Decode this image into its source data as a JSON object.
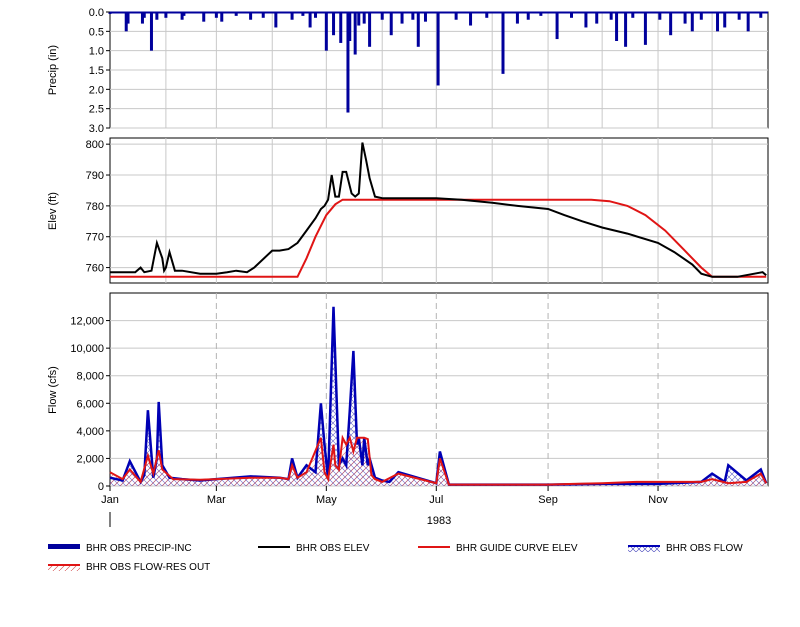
{
  "colors": {
    "precip": "#00009c",
    "elev": "#000000",
    "guide": "#e01515",
    "flow": "#0000b4",
    "res_out": "#e01515",
    "grid": "#c8c8c8",
    "month_line": "#b4b4b4"
  },
  "chart_data": [
    {
      "type": "bar",
      "ylabel": "Precip (in)",
      "ylim": [
        0.0,
        3.0
      ],
      "y_inverted": true,
      "yticks": [
        "0.0",
        "0.5",
        "1.0",
        "1.5",
        "2.0",
        "2.5",
        "3.0"
      ],
      "grid": true,
      "series": [
        {
          "name": "BHR OBS PRECIP-INC",
          "x": [
            "Jan 01",
            "Jan 10",
            "Jan 11",
            "Jan 19",
            "Jan 20",
            "Jan 24",
            "Jan 27",
            "Feb 01",
            "Feb 10",
            "Feb 11",
            "Feb 22",
            "Mar 01",
            "Mar 04",
            "Mar 12",
            "Mar 20",
            "Mar 27",
            "Apr 03",
            "Apr 12",
            "Apr 18",
            "Apr 22",
            "Apr 25",
            "May 01",
            "May 05",
            "May 09",
            "May 13",
            "May 14",
            "May 17",
            "May 19",
            "May 22",
            "May 25",
            "Jun 01",
            "Jun 06",
            "Jun 12",
            "Jun 18",
            "Jun 21",
            "Jun 25",
            "Jul 02",
            "Jul 12",
            "Jul 20",
            "Jul 29",
            "Aug 07",
            "Aug 15",
            "Aug 21",
            "Aug 28",
            "Sep 06",
            "Sep 14",
            "Sep 22",
            "Sep 28",
            "Oct 06",
            "Oct 09",
            "Oct 14",
            "Oct 18",
            "Oct 25",
            "Nov 02",
            "Nov 08",
            "Nov 16",
            "Nov 20",
            "Nov 25",
            "Dec 04",
            "Dec 08",
            "Dec 16",
            "Dec 21",
            "Dec 28"
          ],
          "values": [
            0.05,
            0.5,
            0.3,
            0.3,
            0.15,
            1.0,
            0.2,
            0.15,
            0.2,
            0.1,
            0.25,
            0.15,
            0.25,
            0.1,
            0.2,
            0.15,
            0.4,
            0.2,
            0.1,
            0.4,
            0.15,
            1.0,
            0.6,
            0.8,
            2.6,
            0.75,
            1.1,
            0.35,
            0.3,
            0.9,
            0.2,
            0.6,
            0.3,
            0.2,
            0.9,
            0.25,
            1.9,
            0.2,
            0.35,
            0.15,
            1.6,
            0.3,
            0.2,
            0.1,
            0.7,
            0.15,
            0.4,
            0.3,
            0.2,
            0.75,
            0.9,
            0.15,
            0.85,
            0.2,
            0.6,
            0.3,
            0.5,
            0.2,
            0.5,
            0.4,
            0.2,
            0.5,
            0.15
          ]
        }
      ]
    },
    {
      "type": "line",
      "ylabel": "Elev (ft)",
      "ylim": [
        755,
        802
      ],
      "yticks": [
        "760",
        "770",
        "780",
        "790",
        "800"
      ],
      "grid": true,
      "series": [
        {
          "name": "BHR OBS ELEV",
          "x": [
            "Jan 01",
            "Jan 15",
            "Jan 18",
            "Jan 20",
            "Jan 24",
            "Jan 27",
            "Jan 30",
            "Jan 31",
            "Feb 01",
            "Feb 03",
            "Feb 06",
            "Feb 10",
            "Feb 20",
            "Mar 01",
            "Mar 07",
            "Mar 12",
            "Mar 18",
            "Mar 22",
            "Apr 01",
            "Apr 05",
            "Apr 10",
            "Apr 15",
            "Apr 20",
            "Apr 25",
            "Apr 28",
            "Apr 30",
            "May 02",
            "May 04",
            "May 06",
            "May 08",
            "May 10",
            "May 12",
            "May 15",
            "May 17",
            "May 19",
            "May 21",
            "May 23",
            "May 25",
            "May 28",
            "Jun 01",
            "Jun 10",
            "Jun 20",
            "Jul 01",
            "Jul 15",
            "Aug 01",
            "Aug 15",
            "Sep 01",
            "Sep 10",
            "Sep 20",
            "Oct 01",
            "Oct 15",
            "Nov 01",
            "Nov 10",
            "Nov 20",
            "Nov 25",
            "Dec 01",
            "Dec 15",
            "Dec 29",
            "Dec 31"
          ],
          "values": [
            758.5,
            758.5,
            760,
            758.5,
            759,
            768,
            763,
            759,
            760,
            765,
            759,
            759,
            758,
            758,
            758.5,
            759,
            758.5,
            760,
            765.5,
            765.5,
            766,
            768,
            772,
            776,
            779,
            780,
            782,
            790,
            783,
            783,
            791,
            791,
            784,
            783,
            784,
            800.5,
            795,
            789,
            783,
            782.5,
            782.5,
            782.5,
            782.5,
            782,
            781,
            780,
            779,
            777,
            775,
            773,
            771,
            768,
            765,
            761,
            758,
            757,
            757,
            758.5,
            757.5
          ]
        },
        {
          "name": "BHR GUIDE CURVE ELEV",
          "x": [
            "Jan 01",
            "Apr 15",
            "Apr 20",
            "Apr 25",
            "May 01",
            "May 06",
            "May 10",
            "Sep 25",
            "Oct 05",
            "Oct 15",
            "Oct 25",
            "Nov 05",
            "Nov 15",
            "Nov 25",
            "Dec 01",
            "Dec 31"
          ],
          "values": [
            757,
            757,
            763,
            770,
            777,
            780.5,
            782,
            782,
            781.5,
            780,
            777,
            772,
            766,
            760,
            757,
            757
          ]
        }
      ]
    },
    {
      "type": "area",
      "ylabel": "Flow (cfs)",
      "xlabel": "1983",
      "ylim": [
        0,
        14000
      ],
      "yticks": [
        "0",
        "2,000",
        "4,000",
        "6,000",
        "8,000",
        "10,000",
        "12,000"
      ],
      "xticks": [
        "Jan",
        "Mar",
        "May",
        "Jul",
        "Sep",
        "Nov"
      ],
      "grid": true,
      "series": [
        {
          "name": "BHR OBS FLOW",
          "x": [
            "Jan 01",
            "Jan 08",
            "Jan 12",
            "Jan 18",
            "Jan 20",
            "Jan 22",
            "Jan 25",
            "Jan 27",
            "Jan 28",
            "Jan 30",
            "Feb 03",
            "Feb 10",
            "Feb 20",
            "Mar 01",
            "Mar 20",
            "Apr 05",
            "Apr 10",
            "Apr 12",
            "Apr 15",
            "Apr 20",
            "Apr 25",
            "Apr 28",
            "Apr 30",
            "May 02",
            "May 05",
            "May 08",
            "May 10",
            "May 12",
            "May 14",
            "May 16",
            "May 18",
            "May 19",
            "May 21",
            "May 22",
            "May 24",
            "May 25",
            "May 28",
            "Jun 01",
            "Jun 05",
            "Jun 10",
            "Jul 01",
            "Jul 03",
            "Jul 08",
            "Aug 01",
            "Sep 01",
            "Oct 01",
            "Nov 01",
            "Nov 25",
            "Dec 01",
            "Dec 08",
            "Dec 10",
            "Dec 20",
            "Dec 28",
            "Dec 31"
          ],
          "values": [
            600,
            400,
            1800,
            300,
            800,
            5500,
            600,
            2000,
            6100,
            1500,
            600,
            500,
            400,
            500,
            700,
            600,
            500,
            2000,
            600,
            1500,
            1000,
            6000,
            3000,
            500,
            13000,
            1500,
            2000,
            1500,
            5500,
            9800,
            3000,
            3500,
            1500,
            3500,
            1500,
            2000,
            600,
            400,
            300,
            1000,
            200,
            2500,
            100,
            100,
            100,
            150,
            150,
            300,
            900,
            300,
            1500,
            400,
            1200,
            200
          ]
        },
        {
          "name": "BHR OBS FLOW-RES OUT",
          "x": [
            "Jan 01",
            "Jan 08",
            "Jan 12",
            "Jan 18",
            "Jan 22",
            "Jan 25",
            "Jan 28",
            "Jan 30",
            "Feb 05",
            "Feb 20",
            "Mar 01",
            "Mar 20",
            "Apr 05",
            "Apr 10",
            "Apr 12",
            "Apr 15",
            "Apr 20",
            "Apr 28",
            "Apr 30",
            "May 02",
            "May 05",
            "May 06",
            "May 08",
            "May 10",
            "May 12",
            "May 14",
            "May 16",
            "May 18",
            "May 20",
            "May 22",
            "May 24",
            "May 26",
            "May 28",
            "Jun 01",
            "Jun 10",
            "Jul 01",
            "Jul 03",
            "Jul 08",
            "Aug 01",
            "Sep 01",
            "Sep 15",
            "Oct 01",
            "Oct 20",
            "Nov 01",
            "Nov 25",
            "Dec 01",
            "Dec 10",
            "Dec 20",
            "Dec 28",
            "Dec 31"
          ],
          "values": [
            1000,
            500,
            1200,
            300,
            2200,
            900,
            2600,
            1200,
            500,
            450,
            500,
            600,
            600,
            500,
            1500,
            600,
            1000,
            3500,
            1000,
            500,
            3000,
            1500,
            1200,
            3500,
            3000,
            3500,
            2500,
            3500,
            3500,
            3500,
            3400,
            800,
            500,
            300,
            900,
            200,
            2000,
            100,
            100,
            100,
            150,
            200,
            300,
            300,
            300,
            500,
            200,
            300,
            900,
            200
          ]
        }
      ]
    }
  ],
  "legend": {
    "items": [
      {
        "label": "BHR OBS PRECIP-INC",
        "style": "thick-bar"
      },
      {
        "label": "BHR OBS ELEV",
        "style": "line"
      },
      {
        "label": "BHR GUIDE CURVE ELEV",
        "style": "line"
      },
      {
        "label": "BHR OBS FLOW",
        "style": "hatch"
      },
      {
        "label": "BHR OBS FLOW-RES OUT",
        "style": "hatch"
      }
    ]
  }
}
